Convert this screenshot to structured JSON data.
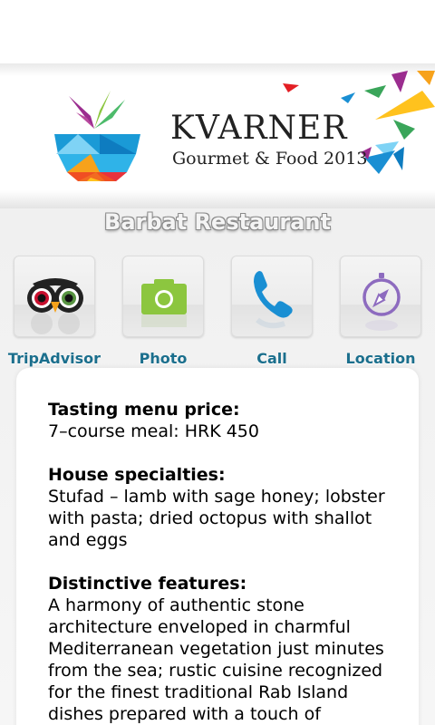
{
  "banner": {
    "logo_title": "KVARNER",
    "logo_subtitle": "Gourmet & Food 2013"
  },
  "restaurant": {
    "name": "Barbat Restaurant"
  },
  "actions": [
    {
      "label": "TripAdvisor",
      "icon": "tripadvisor-owl-icon"
    },
    {
      "label": "Photo",
      "icon": "camera-icon"
    },
    {
      "label": "Call",
      "icon": "phone-icon"
    },
    {
      "label": "Location",
      "icon": "compass-icon"
    }
  ],
  "details": {
    "tasting_heading": "Tasting menu price:",
    "tasting_body": "7–course meal: HRK 450",
    "specialties_heading": "House specialties:",
    "specialties_body": "Stufad – lamb with sage honey; lobster with pasta; dried octopus with shallot and eggs",
    "features_heading": "Distinctive features:",
    "features_body": "A harmony of authentic stone architecture enveloped in charmful Mediterranean vegetation just minutes from the sea; rustic cuisine recognized for the finest traditional Rab Island dishes prepared with a touch of"
  },
  "colors": {
    "label_blue": "#1b6f8d",
    "camera_green": "#8cc63f",
    "phone_blue": "#1a8fd3",
    "compass_purple": "#8d6bbf"
  }
}
